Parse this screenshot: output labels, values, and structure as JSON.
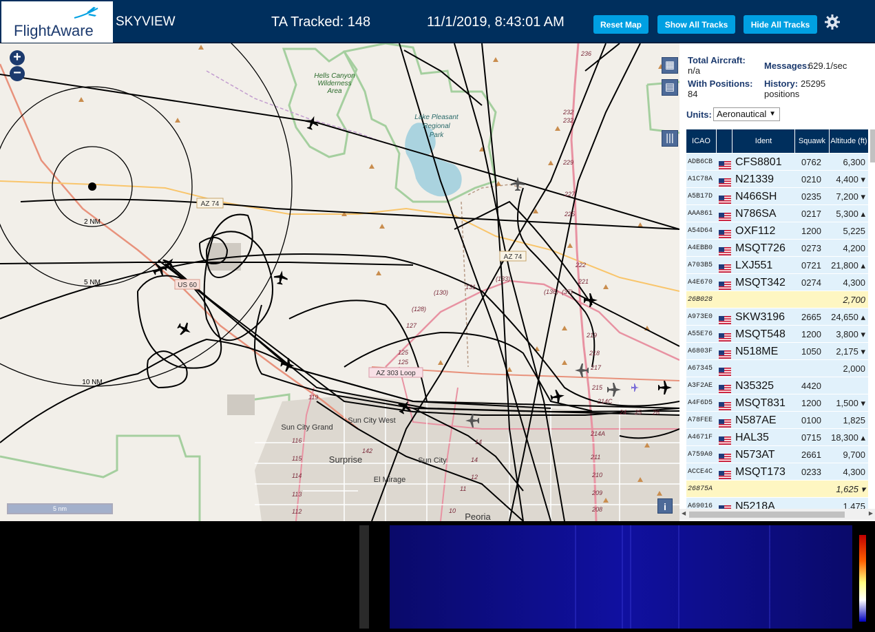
{
  "header": {
    "logo_text": "FlightAware",
    "app_name": "SKYVIEW",
    "tracked": "TA Tracked: 148",
    "datetime": "11/1/2019, 8:43:01 AM",
    "buttons": {
      "reset": "Reset Map",
      "show": "Show All Tracks",
      "hide": "Hide All Tracks"
    }
  },
  "map": {
    "zoom_in": "+",
    "zoom_out": "−",
    "scale": "5 nm",
    "info": "i",
    "labels": {
      "hells_canyon": "Hells Canyon",
      "wilderness": "Wilderness",
      "area": "Area",
      "lake1": "Lake Pleasant",
      "lake2": "Regional",
      "lake3": "Park",
      "az74_a": "AZ 74",
      "az74_b": "AZ 74",
      "us60": "US 60",
      "az303": "AZ 303 Loop",
      "ring2": "2 NM",
      "ring5": "5 NM",
      "ring10": "10 NM",
      "sun_city_grand": "Sun City Grand",
      "sun_city_west": "Sun City West",
      "surprise": "Surprise",
      "sun_city": "Sun City",
      "el_mirage": "El Mirage",
      "peoria": "Peoria",
      "r236": "236",
      "r232a": "232",
      "r232b": "232",
      "r229": "229",
      "r227": "227",
      "r225": "225",
      "r222": "222",
      "r221": "221",
      "r219": "219",
      "r218": "218",
      "r217": "217",
      "r215": "215",
      "r214c": "214C",
      "r214a": "214A",
      "r211": "211",
      "r210": "210",
      "r209": "209",
      "r208": "208",
      "r131": "131",
      "r133": "(133)",
      "r130": "(130)",
      "r136": "(136)",
      "r37": "(37)",
      "r128": "(128)",
      "r127": "127",
      "r125": "125",
      "r125b": "125",
      "r119": "119",
      "r116": "116",
      "r115": "115",
      "r114": "114",
      "r113": "113",
      "r112": "112",
      "r142": "142",
      "r14": "14",
      "r14b": "14",
      "r12": "12",
      "r11": "11",
      "r10": "10",
      "r24": "24",
      "r25": "25",
      "r26": "26"
    }
  },
  "panel": {
    "total_label": "Total Aircraft:",
    "total_value": "n/a",
    "positions_label": "With Positions:",
    "positions_value": "84",
    "messages_label": "Messages:",
    "messages_value": "629.1/sec",
    "history_label": "History:",
    "history_value": "25295",
    "history_unit": "positions",
    "units_label": "Units:",
    "units_value": "Aeronautical",
    "columns": [
      "ICAO",
      "",
      "Ident",
      "Squawk",
      "Altitude (ft)"
    ],
    "rows": [
      {
        "icao": "ADB6CB",
        "flag": true,
        "ident": "CFS8801",
        "squawk": "0762",
        "alt": "6,300",
        "hl": false
      },
      {
        "icao": "A1C78A",
        "flag": true,
        "ident": "N21339",
        "squawk": "0210",
        "alt": "4,400 ▾",
        "hl": false
      },
      {
        "icao": "A5B17D",
        "flag": true,
        "ident": "N466SH",
        "squawk": "0235",
        "alt": "7,200 ▾",
        "hl": false
      },
      {
        "icao": "AAA861",
        "flag": true,
        "ident": "N786SA",
        "squawk": "0217",
        "alt": "5,300 ▴",
        "hl": false
      },
      {
        "icao": "A54D64",
        "flag": true,
        "ident": "OXF112",
        "squawk": "1200",
        "alt": "5,225",
        "hl": false
      },
      {
        "icao": "A4EBB0",
        "flag": true,
        "ident": "MSQT726",
        "squawk": "0273",
        "alt": "4,200",
        "hl": false
      },
      {
        "icao": "A703B5",
        "flag": true,
        "ident": "LXJ551",
        "squawk": "0721",
        "alt": "21,800 ▴",
        "hl": false
      },
      {
        "icao": "A4E670",
        "flag": true,
        "ident": "MSQT342",
        "squawk": "0274",
        "alt": "4,300",
        "hl": false
      },
      {
        "icao": "26B028",
        "flag": false,
        "ident": "",
        "squawk": "",
        "alt": "2,700",
        "hl": true
      },
      {
        "icao": "A973E0",
        "flag": true,
        "ident": "SKW3196",
        "squawk": "2665",
        "alt": "24,650 ▴",
        "hl": false
      },
      {
        "icao": "A55E76",
        "flag": true,
        "ident": "MSQT548",
        "squawk": "1200",
        "alt": "3,800 ▾",
        "hl": false
      },
      {
        "icao": "A6803F",
        "flag": true,
        "ident": "N518ME",
        "squawk": "1050",
        "alt": "2,175 ▾",
        "hl": false
      },
      {
        "icao": "A67345",
        "flag": true,
        "ident": "",
        "squawk": "",
        "alt": "2,000",
        "hl": false
      },
      {
        "icao": "A3F2AE",
        "flag": true,
        "ident": "N35325",
        "squawk": "4420",
        "alt": "",
        "hl": false
      },
      {
        "icao": "A4F6D5",
        "flag": true,
        "ident": "MSQT831",
        "squawk": "1200",
        "alt": "1,500 ▾",
        "hl": false
      },
      {
        "icao": "A78FEE",
        "flag": true,
        "ident": "N587AE",
        "squawk": "0100",
        "alt": "1,825",
        "hl": false
      },
      {
        "icao": "A4671F",
        "flag": true,
        "ident": "HAL35",
        "squawk": "0715",
        "alt": "18,300 ▴",
        "hl": false
      },
      {
        "icao": "A759A0",
        "flag": true,
        "ident": "N573AT",
        "squawk": "2661",
        "alt": "9,700",
        "hl": false
      },
      {
        "icao": "ACCE4C",
        "flag": true,
        "ident": "MSQT173",
        "squawk": "0233",
        "alt": "4,300",
        "hl": false
      },
      {
        "icao": "26875A",
        "flag": false,
        "ident": "",
        "squawk": "",
        "alt": "1,625 ▾",
        "hl": true
      },
      {
        "icao": "A69016",
        "flag": true,
        "ident": "N5218A",
        "squawk": "",
        "alt": "1,475",
        "hl": false
      }
    ]
  },
  "colors": {
    "header": "#002f5d",
    "accent": "#00a0e2",
    "row": "#e1f1fb",
    "row_highlight": "#fef6c2",
    "map_bg": "#f2efe9"
  }
}
